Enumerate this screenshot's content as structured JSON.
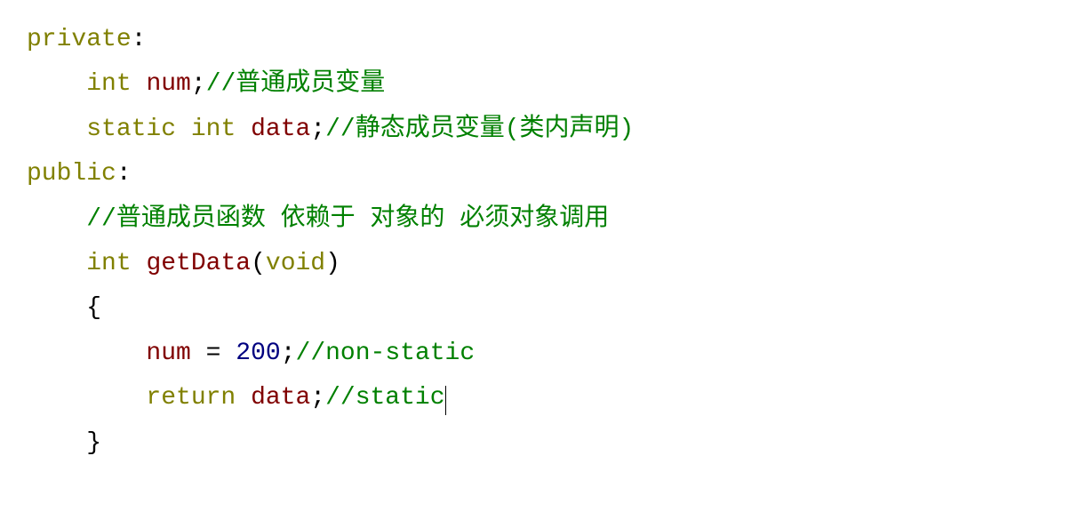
{
  "code": {
    "line1": {
      "keyword": "private",
      "colon": ":"
    },
    "line2": {
      "indent": "    ",
      "type": "int",
      "space": " ",
      "identifier": "num",
      "semi": ";",
      "comment": "//普通成员变量"
    },
    "line3": {
      "indent": "    ",
      "keyword": "static",
      "space": " ",
      "type": "int",
      "space2": " ",
      "identifier": "data",
      "semi": ";",
      "comment": "//静态成员变量(类内声明)"
    },
    "line4": {
      "keyword": "public",
      "colon": ":"
    },
    "line5": {
      "indent": "    ",
      "comment": "//普通成员函数 依赖于 对象的 必须对象调用"
    },
    "line6": {
      "indent": "    ",
      "type": "int",
      "space": " ",
      "identifier": "getData",
      "lparen": "(",
      "voidkw": "void",
      "rparen": ")"
    },
    "line7": {
      "indent": "    ",
      "brace": "{"
    },
    "line8": {
      "indent": "        ",
      "identifier": "num",
      "space": " ",
      "eq": "=",
      "space2": " ",
      "number": "200",
      "semi": ";",
      "comment": "//non-static"
    },
    "line9": {
      "indent": "        ",
      "keyword": "return",
      "space": " ",
      "identifier": "data",
      "semi": ";",
      "comment": "//static"
    },
    "line10": {
      "indent": "    ",
      "brace": "}"
    }
  }
}
